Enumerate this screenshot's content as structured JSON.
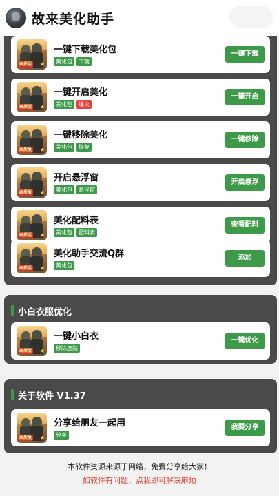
{
  "header": {
    "title": "故来美化助手",
    "logo_icon": "avatar-logo-icon"
  },
  "section1": {
    "items": [
      {
        "name": "一键下载美化包",
        "badges": [
          "美化包",
          "下载"
        ],
        "badge_colors": [
          "#3d9a48",
          "#3d9a48"
        ],
        "action": "一键下载",
        "thumb_tag": "画质版"
      },
      {
        "name": "一键开启美化",
        "badges": [
          "美化包",
          "爆火"
        ],
        "badge_colors": [
          "#3d9a48",
          "#e8403a"
        ],
        "action": "一键开启",
        "thumb_tag": "画质版"
      },
      {
        "name": "一键移除美化",
        "badges": [
          "美化包",
          "恢复"
        ],
        "badge_colors": [
          "#3d9a48",
          "#3d9a48"
        ],
        "action": "一键移除",
        "thumb_tag": "画质版"
      },
      {
        "name": "开启悬浮窗",
        "badges": [
          "美化包",
          "悬浮窗"
        ],
        "badge_colors": [
          "#3d9a48",
          "#3d9a48"
        ],
        "action": "开启悬浮",
        "thumb_tag": "画质版"
      },
      {
        "name": "美化配料表",
        "badges": [
          "美化包",
          "配料表"
        ],
        "badge_colors": [
          "#3d9a48",
          "#3d9a48"
        ],
        "action": "查看配料",
        "thumb_tag": "画质版"
      },
      {
        "name": "美化助手交流Q群",
        "badges": [
          "美化包"
        ],
        "badge_colors": [
          "#3d9a48"
        ],
        "action": "添加",
        "thumb_tag": "画质版"
      }
    ]
  },
  "section2": {
    "title": "小白衣服优化",
    "items": [
      {
        "name": "一键小白衣",
        "badges": [
          "移除皮肤"
        ],
        "badge_colors": [
          "#3d9a48"
        ],
        "action": "一键优化",
        "thumb_tag": "画质版"
      }
    ]
  },
  "section3": {
    "title": "关于软件 V1.37",
    "items": [
      {
        "name": "分享给朋友一起用",
        "badges": [
          "分享"
        ],
        "badge_colors": [
          "#3d9a48"
        ],
        "action": "我要分享",
        "thumb_tag": "画质版"
      }
    ]
  },
  "footer": {
    "line1": "本软件资源来源于网络，免费分享给大家！",
    "line2": "如软件有问题，点我即可解决麻烦"
  },
  "colors": {
    "accent_green": "#3d9a48",
    "hot_red": "#e8403a",
    "panel_bg": "#4a4a4a",
    "footer_link": "#e03a30"
  }
}
